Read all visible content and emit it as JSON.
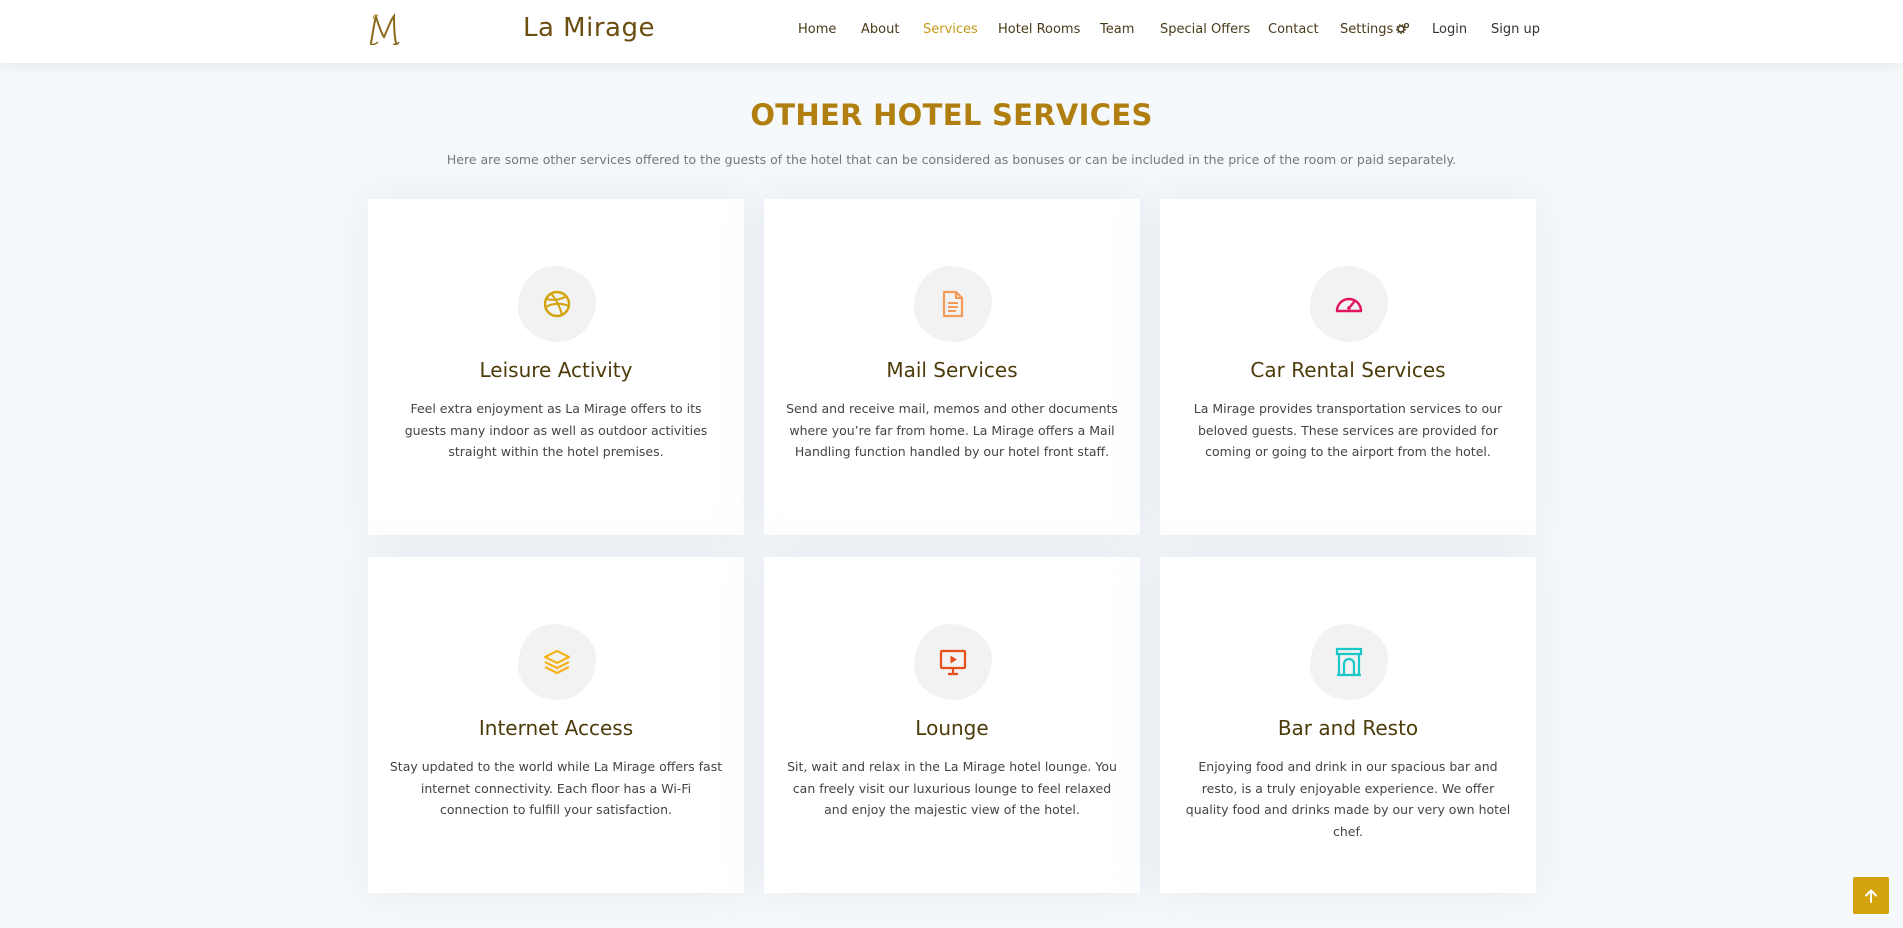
{
  "brand": {
    "name": "La Mirage",
    "logo_letter": "M"
  },
  "nav": {
    "home": "Home",
    "about": "About",
    "services": "Services",
    "rooms": "Hotel Rooms",
    "team": "Team",
    "offers": "Special Offers",
    "contact": "Contact",
    "settings": "Settings",
    "login": "Login",
    "signup": "Sign up"
  },
  "section": {
    "title": "OTHER HOTEL SERVICES",
    "subtitle": "Here are some other services offered to the guests of the hotel that can be considered as bonuses or can be included in the price of the room or paid separately."
  },
  "services": [
    {
      "title": "Leisure Activity",
      "text": "Feel extra enjoyment as La Mirage offers to its guests many indoor as well as outdoor activities straight within the hotel premises.",
      "icon": "dribbble-icon",
      "color": "#d4a20a"
    },
    {
      "title": "Mail Services",
      "text": "Send and receive mail, memos and other documents where you’re far from home. La Mirage offers a Mail Handling function handled by our hotel front staff.",
      "icon": "document-icon",
      "color": "#f59b58"
    },
    {
      "title": "Car Rental Services",
      "text": "La Mirage provides transportation services to our beloved guests. These services are provided for coming or going to the airport from the hotel.",
      "icon": "speedometer-icon",
      "color": "#e4135f"
    },
    {
      "title": "Internet Access",
      "text": "Stay updated to the world while La Mirage offers fast internet connectivity. Each floor has a Wi-Fi connection to fulfill your satisfaction.",
      "icon": "layers-icon",
      "color": "#f5b21a"
    },
    {
      "title": "Lounge",
      "text": "Sit, wait and relax in the La Mirage hotel lounge. You can freely visit our luxurious lounge to feel relaxed and enjoy the majestic view of the hotel.",
      "icon": "presentation-icon",
      "color": "#e84e1b"
    },
    {
      "title": "Bar and Resto",
      "text": "Enjoying food and drink in our spacious bar and resto, is a truly enjoyable experience. We offer quality food and drinks made by our very own hotel chef.",
      "icon": "arch-icon",
      "color": "#18c8c8"
    }
  ],
  "colors": {
    "accent": "#c49a14",
    "title": "#b07f10",
    "card_title": "#4d3b0a"
  }
}
